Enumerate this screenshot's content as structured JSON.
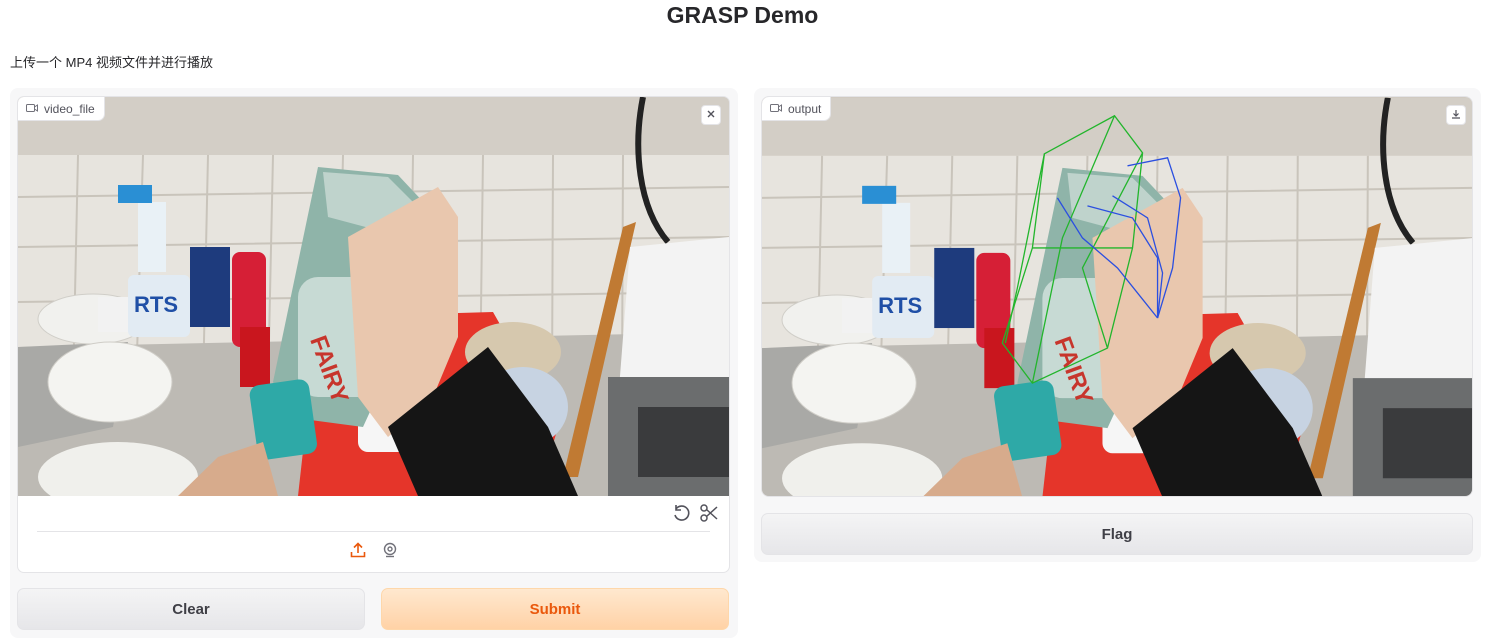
{
  "app": {
    "title": "GRASP Demo",
    "description": "上传一个 MP4 视频文件并进行播放"
  },
  "input_panel": {
    "video_label": "video_file",
    "clear_label": "Clear",
    "submit_label": "Submit"
  },
  "output_panel": {
    "video_label": "output",
    "flag_label": "Flag"
  },
  "icons": {
    "video_label": "video-camera-icon",
    "clear_video": "close-icon",
    "undo": "undo-icon",
    "trim": "scissors-icon",
    "upload": "upload-icon",
    "webcam": "webcam-icon",
    "download": "download-icon"
  },
  "colors": {
    "accent": "#ea580c",
    "hand_mesh_green": "#22b52c",
    "hand_mesh_blue": "#2b4fe0"
  }
}
